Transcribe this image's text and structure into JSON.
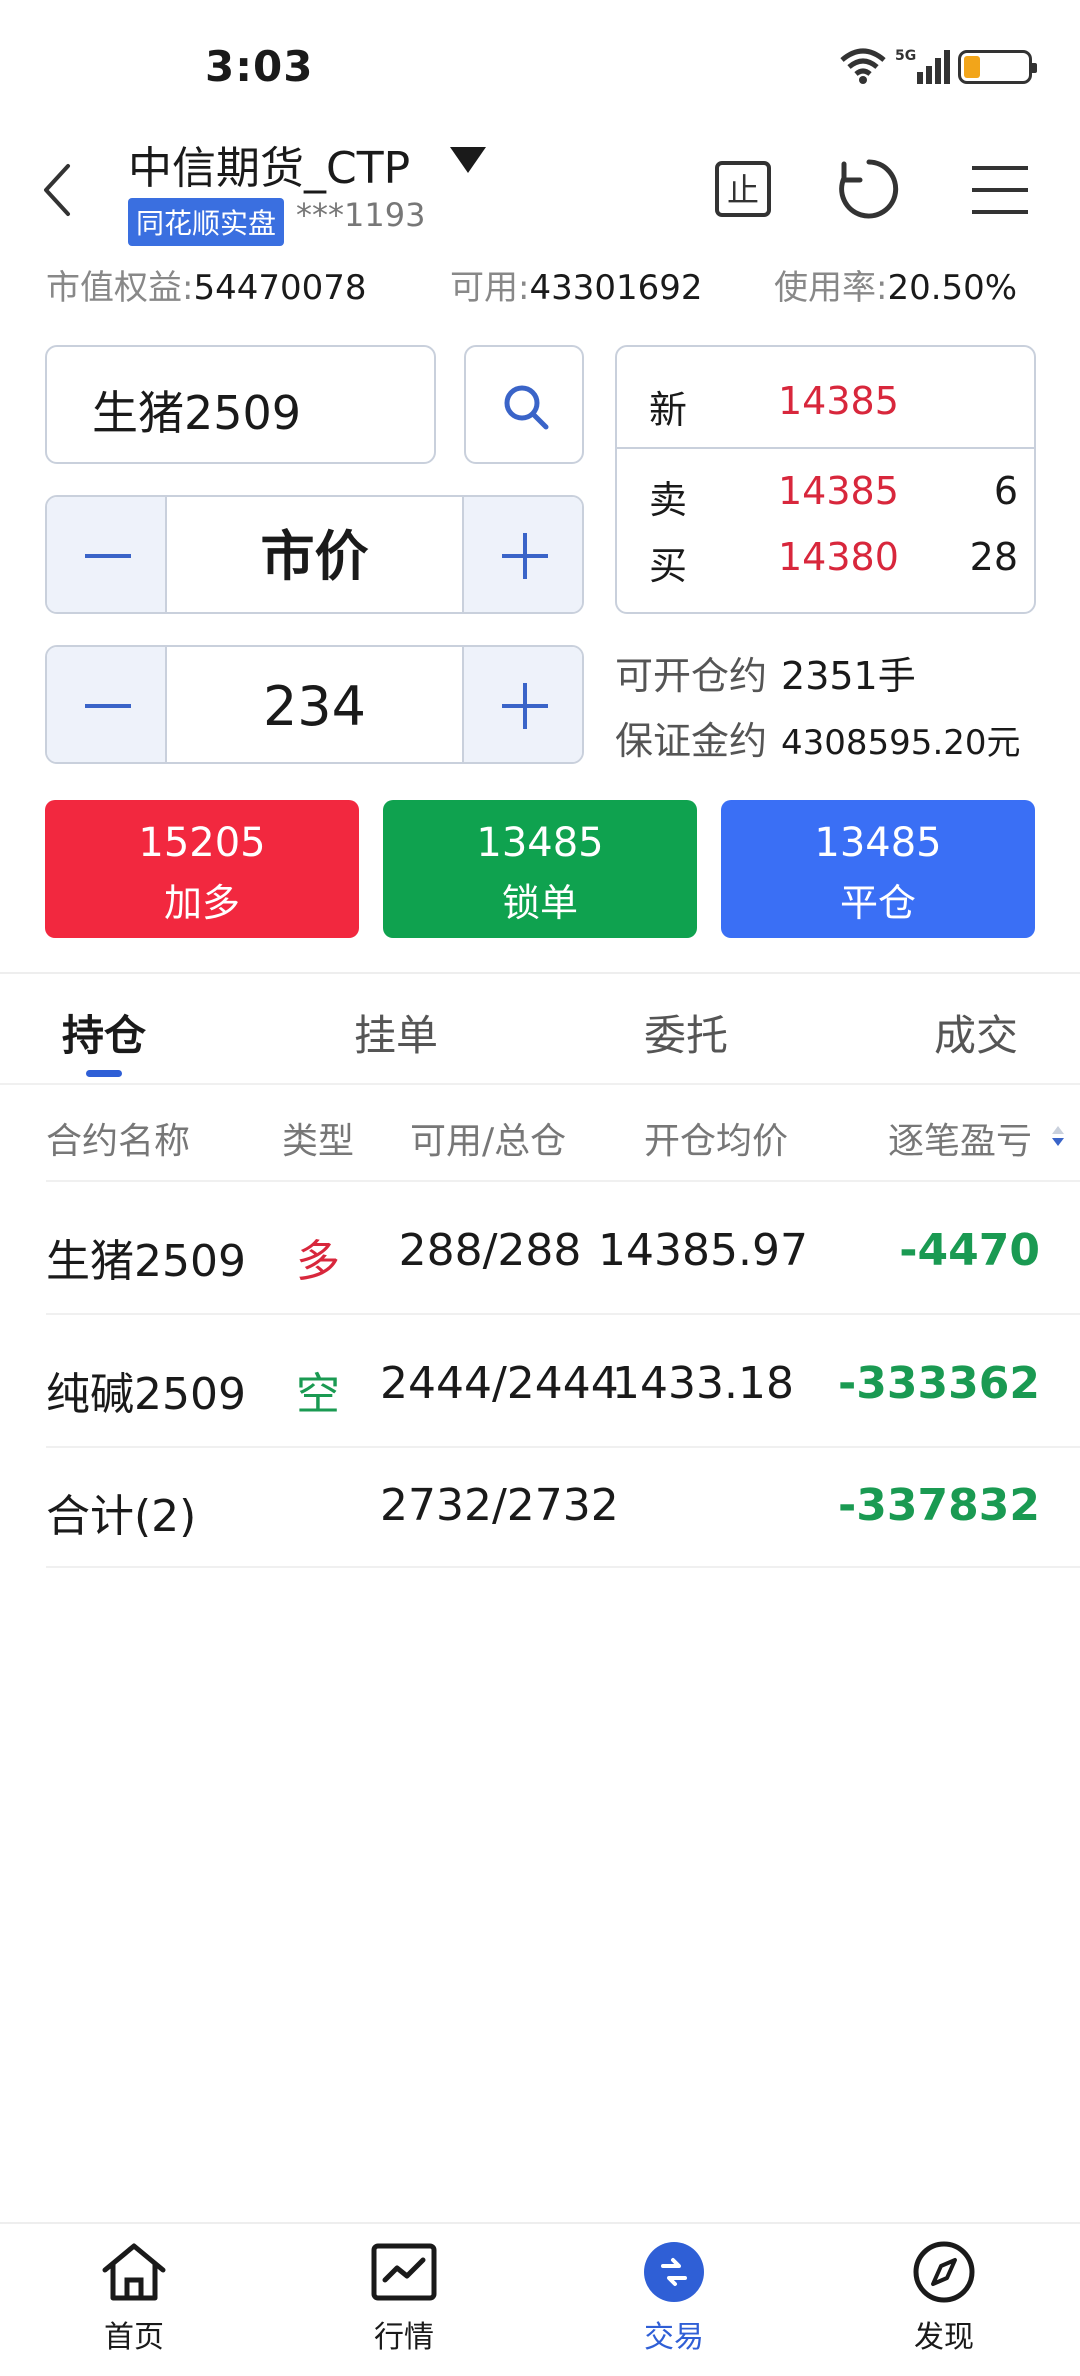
{
  "status_bar": {
    "time": "3:03",
    "network": "5G"
  },
  "header": {
    "broker_name": "中信期货_CTP",
    "real_tag": "同花顺实盘",
    "account": "***1193",
    "stop_label": "止"
  },
  "summary": {
    "equity_label": "市值权益:",
    "equity_value": "54470078",
    "available_label": "可用:",
    "available_value": "43301692",
    "usage_label": "使用率:",
    "usage_value": "20.50%"
  },
  "order": {
    "contract": "生猪2509",
    "price": "市价",
    "quantity": "234"
  },
  "quote": {
    "new_label": "新",
    "new_price": "14385",
    "sell_label": "卖",
    "sell_price": "14385",
    "sell_vol": "6",
    "buy_label": "买",
    "buy_price": "14380",
    "buy_vol": "28"
  },
  "capacity": {
    "can_open_label": "可开仓约",
    "can_open_value": "2351手",
    "margin_label": "保证金约",
    "margin_value": "4308595.20元"
  },
  "actions": {
    "long": {
      "price": "15205",
      "label": "加多",
      "color": "#f2283f"
    },
    "lock": {
      "price": "13485",
      "label": "锁单",
      "color": "#0fa24f"
    },
    "close": {
      "price": "13485",
      "label": "平仓",
      "color": "#3a6ff5"
    }
  },
  "tabs": [
    "持仓",
    "挂单",
    "委托",
    "成交"
  ],
  "table": {
    "headers": [
      "合约名称",
      "类型",
      "可用/总仓",
      "开仓均价",
      "逐笔盈亏"
    ],
    "rows": [
      {
        "name": "生猪2509",
        "type": "多",
        "qty": "288/288",
        "avg": "14385.97",
        "pnl": "-4470"
      },
      {
        "name": "纯碱2509",
        "type": "空",
        "qty": "2444/2444",
        "avg": "1433.18",
        "pnl": "-333362"
      }
    ],
    "total": {
      "name": "合计(2)",
      "qty": "2732/2732",
      "pnl": "-337832"
    }
  },
  "nav": [
    {
      "label": "首页",
      "icon": "home-icon"
    },
    {
      "label": "行情",
      "icon": "chart-icon"
    },
    {
      "label": "交易",
      "icon": "trade-icon",
      "active": true
    },
    {
      "label": "发现",
      "icon": "compass-icon"
    }
  ],
  "colors": {
    "accent": "#2f5fd6",
    "up": "#d8273c",
    "down": "#1a9a52"
  }
}
